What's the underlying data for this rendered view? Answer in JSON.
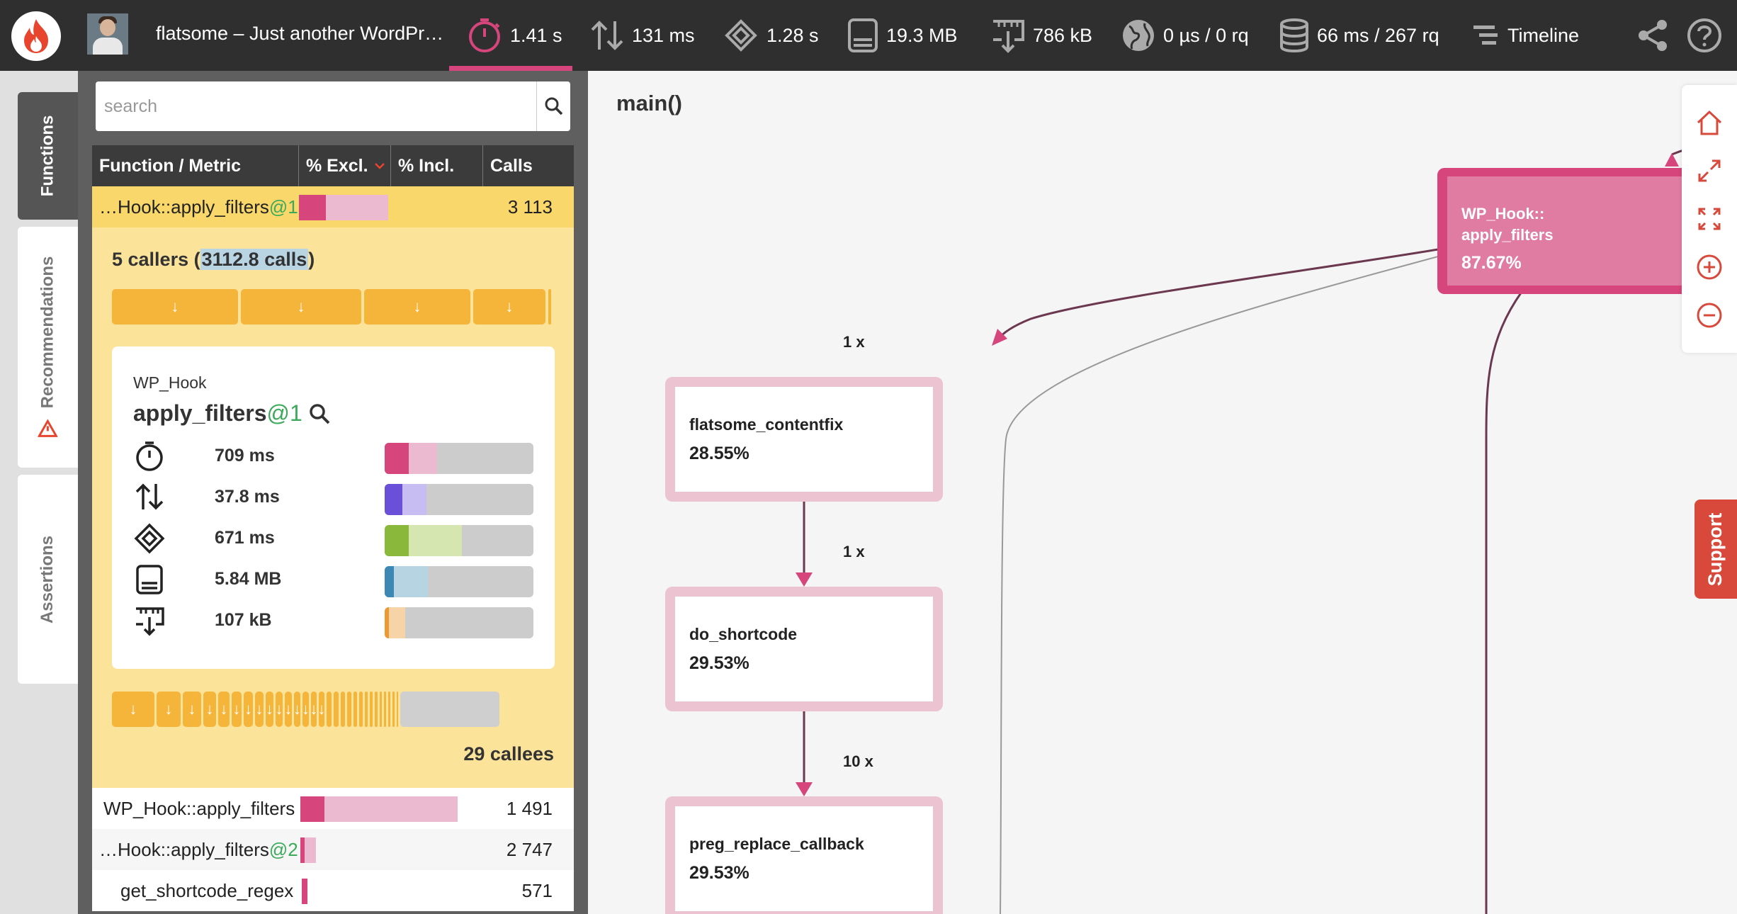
{
  "topbar": {
    "title": "flatsome – Just another WordPr…",
    "metrics": {
      "wall_time": "1.41 s",
      "io_wait": "131 ms",
      "cpu": "1.28 s",
      "memory": "19.3 MB",
      "network": "786 kB",
      "external": "0 µs / 0 rq",
      "sql": "66 ms / 267 rq"
    },
    "timeline_label": "Timeline"
  },
  "tabs": [
    "Functions",
    "Recommendations",
    "Assertions"
  ],
  "search": {
    "placeholder": "search"
  },
  "table": {
    "headers": [
      "Function / Metric",
      "% Excl.",
      "% Incl.",
      "Calls"
    ],
    "selected_row": {
      "name": "…Hook::apply_filters",
      "suffix": "@1",
      "calls": "3 113",
      "excl_pct": 0.18,
      "incl_pct": 0.6
    },
    "callers": {
      "count": "5 callers (",
      "calls": "3112.8 calls",
      "close": ")"
    },
    "detail": {
      "class": "WP_Hook",
      "function": "apply_filters",
      "suffix": "@1",
      "metrics": [
        {
          "icon": "stopwatch-icon",
          "value": "709 ms",
          "fill1": 0.16,
          "fill2": 0.35,
          "color1": "#d6457c",
          "color2": "#ecbad0"
        },
        {
          "icon": "io-arrows-icon",
          "value": "37.8 ms",
          "fill1": 0.12,
          "fill2": 0.28,
          "color1": "#6a4fd8",
          "color2": "#c8bdf2"
        },
        {
          "icon": "cpu-chip-icon",
          "value": "671 ms",
          "fill1": 0.16,
          "fill2": 0.52,
          "color1": "#8ab83a",
          "color2": "#d5e6b0"
        },
        {
          "icon": "memory-icon",
          "value": "5.84 MB",
          "fill1": 0.06,
          "fill2": 0.29,
          "color1": "#3d87b5",
          "color2": "#b6d4e2"
        },
        {
          "icon": "network-icon",
          "value": "107 kB",
          "fill1": 0.03,
          "fill2": 0.14,
          "color1": "#f09830",
          "color2": "#f7d3a8"
        }
      ]
    },
    "callees_label": "29 callees",
    "callee_rows": [
      {
        "name": "WP_Hook::apply_filters",
        "suffix": "",
        "calls": "1 491"
      },
      {
        "name": "…Hook::apply_filters",
        "suffix": "@2",
        "calls": "2 747"
      },
      {
        "name": "get_shortcode_regex",
        "suffix": "",
        "calls": "571"
      }
    ]
  },
  "graph": {
    "title": "main()",
    "nodes": [
      {
        "name": "WP_Hook::",
        "name2": "apply_filters",
        "pct": "87.67%"
      },
      {
        "name": "flatsome_contentfix",
        "pct": "28.55%"
      },
      {
        "name": "do_shortcode",
        "pct": "29.53%"
      },
      {
        "name": "preg_replace_callback",
        "pct": "29.53%"
      }
    ],
    "edges": [
      "1 x",
      "1 x",
      "10 x"
    ]
  },
  "support_label": "Support",
  "colors": {
    "accent": "#d6457c",
    "topbar": "#2f2f2f",
    "selected": "#f9d76b",
    "expand": "#fbe39a",
    "arrow_segment": "#f5b43a",
    "support": "#d9493b"
  }
}
